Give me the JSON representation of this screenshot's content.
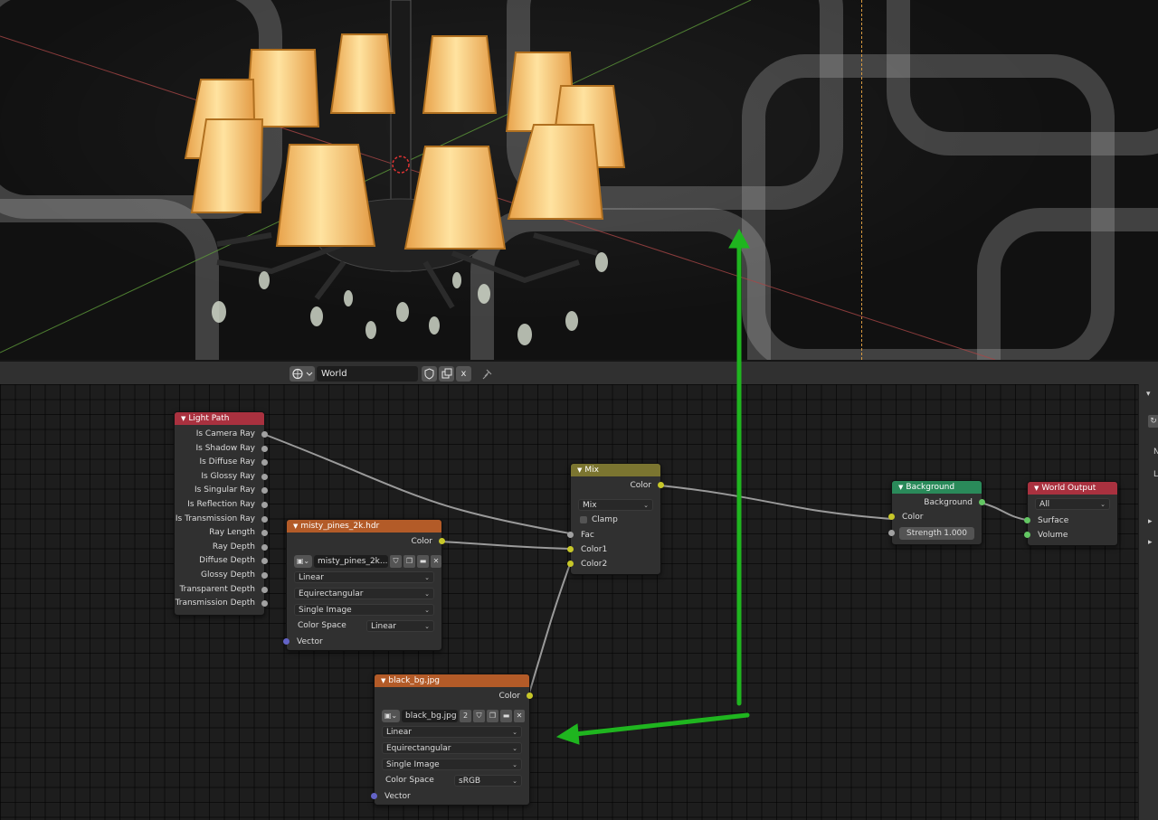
{
  "header": {
    "world_icon": "world-icon",
    "datablock_name": "World",
    "shield_icon": "fake-user-shield-icon",
    "duplicate_icon": "duplicate-icon",
    "close_icon": "x",
    "pin_icon": "pin-icon"
  },
  "sidebar": {
    "collapse_arrow": "▾",
    "icon": "↻",
    "letter_n": "N",
    "letter_l": "L",
    "arrow1": "▸",
    "arrow2": "▸"
  },
  "nodes": {
    "light_path": {
      "title": "Light Path",
      "outputs": [
        "Is Camera Ray",
        "Is Shadow Ray",
        "Is Diffuse Ray",
        "Is Glossy Ray",
        "Is Singular Ray",
        "Is Reflection Ray",
        "Is Transmission Ray",
        "Ray Length",
        "Ray Depth",
        "Diffuse Depth",
        "Glossy Depth",
        "Transparent Depth",
        "Transmission Depth"
      ]
    },
    "misty": {
      "title": "misty_pines_2k.hdr",
      "output": "Color",
      "image_name": "misty_pines_2k...",
      "interpolation": "Linear",
      "projection": "Equirectangular",
      "source": "Single Image",
      "color_space_label": "Color Space",
      "color_space": "Linear",
      "vector": "Vector"
    },
    "black_bg": {
      "title": "black_bg.jpg",
      "output": "Color",
      "image_name": "black_bg.jpg",
      "users": "2",
      "interpolation": "Linear",
      "projection": "Equirectangular",
      "source": "Single Image",
      "color_space_label": "Color Space",
      "color_space": "sRGB",
      "vector": "Vector"
    },
    "mix": {
      "title": "Mix",
      "output": "Color",
      "blend": "Mix",
      "clamp": "Clamp",
      "fac": "Fac",
      "color1": "Color1",
      "color2": "Color2"
    },
    "background": {
      "title": "Background",
      "output": "Background",
      "color": "Color",
      "strength_label": "Strength",
      "strength": "1.000"
    },
    "world_output": {
      "title": "World Output",
      "target": "All",
      "surface": "Surface",
      "volume": "Volume"
    }
  },
  "colors": {
    "header_red": "#a9313f",
    "header_orange": "#b35b28",
    "header_olive": "#7b7530",
    "header_green": "#2a8a5a",
    "socket_yellow": "#c7c729",
    "socket_gray": "#a1a1a1",
    "socket_green": "#63c763",
    "socket_violet": "#6363c7",
    "annotation_arrow": "#1fb51f"
  }
}
